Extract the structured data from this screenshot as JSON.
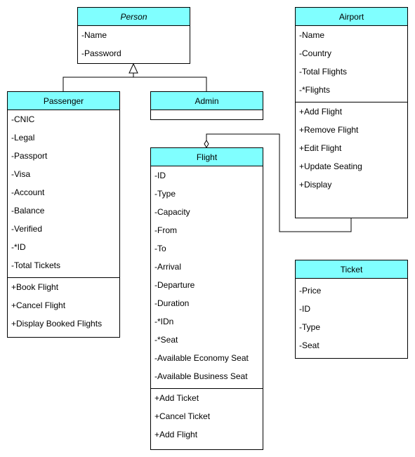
{
  "classes": {
    "person": {
      "name": "Person",
      "attributes": [
        "-Name",
        "-Password"
      ],
      "operations": []
    },
    "airport": {
      "name": "Airport",
      "attributes": [
        "-Name",
        "-Country",
        "-Total Flights",
        "-*Flights"
      ],
      "operations": [
        "+Add Flight",
        "+Remove Flight",
        "+Edit Flight",
        "+Update Seating",
        "+Display"
      ]
    },
    "passenger": {
      "name": "Passenger",
      "attributes": [
        "-CNIC",
        "-Legal",
        "-Passport",
        "-Visa",
        "-Account",
        "-Balance",
        "-Verified",
        "-*ID",
        "-Total Tickets"
      ],
      "operations": [
        "+Book Flight",
        "+Cancel Flight",
        "+Display Booked Flights"
      ]
    },
    "admin": {
      "name": "Admin",
      "attributes": [],
      "operations": []
    },
    "flight": {
      "name": "Flight",
      "attributes": [
        "-ID",
        "-Type",
        "-Capacity",
        "-From",
        "-To",
        "-Arrival",
        "-Departure",
        "-Duration",
        "-*IDn",
        "-*Seat",
        "-Available Economy Seat",
        "-Available Business Seat"
      ],
      "operations": [
        "+Add Ticket",
        "+Cancel Ticket",
        "+Add Flight"
      ]
    },
    "ticket": {
      "name": "Ticket",
      "attributes": [
        "-Price",
        "-ID",
        "-Type",
        "-Seat"
      ],
      "operations": []
    }
  },
  "colors": {
    "header_fill": "#80ffff",
    "border": "#000000"
  }
}
